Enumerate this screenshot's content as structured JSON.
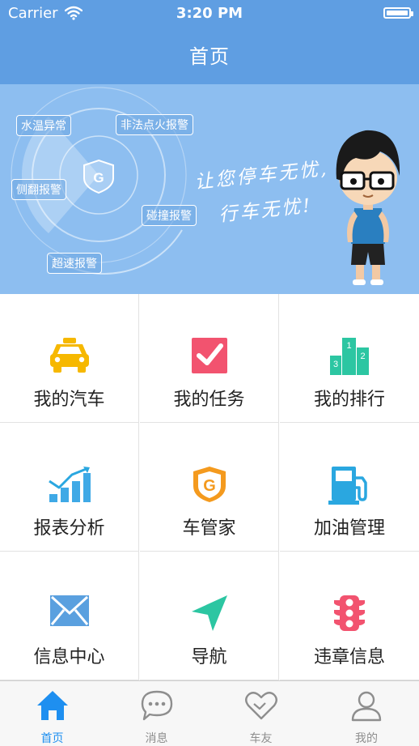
{
  "status_bar": {
    "carrier": "Carrier",
    "time": "3:20 PM"
  },
  "nav": {
    "title": "首页"
  },
  "banner": {
    "tags": [
      "水温异常",
      "非法点火报警",
      "侧翻报警",
      "碰撞报警",
      "超速报警"
    ],
    "slogan_line1": "让您停车无忧,",
    "slogan_line2": "行车无忧!"
  },
  "grid": {
    "items": [
      {
        "label": "我的汽车",
        "icon": "car-icon",
        "color": "#f6b800"
      },
      {
        "label": "我的任务",
        "icon": "task-check-icon",
        "color": "#f2536f"
      },
      {
        "label": "我的排行",
        "icon": "ranking-podium-icon",
        "color": "#2cc6a2"
      },
      {
        "label": "报表分析",
        "icon": "report-chart-icon",
        "color": "#3fa9e6"
      },
      {
        "label": "车管家",
        "icon": "car-butler-shield-icon",
        "color": "#f49a1e"
      },
      {
        "label": "加油管理",
        "icon": "fuel-pump-icon",
        "color": "#2aa7e0"
      },
      {
        "label": "信息中心",
        "icon": "envelope-icon",
        "color": "#5aa0df"
      },
      {
        "label": "导航",
        "icon": "navigation-arrow-icon",
        "color": "#2cc6a2"
      },
      {
        "label": "违章信息",
        "icon": "traffic-light-icon",
        "color": "#f2536f"
      }
    ]
  },
  "tabbar": {
    "tabs": [
      {
        "label": "首页",
        "icon": "home-icon",
        "active": true
      },
      {
        "label": "消息",
        "icon": "chat-bubble-icon",
        "active": false
      },
      {
        "label": "车友",
        "icon": "heart-icon",
        "active": false
      },
      {
        "label": "我的",
        "icon": "person-icon",
        "active": false
      }
    ],
    "active_color": "#1e8ff0",
    "inactive_color": "#8e8e8e"
  },
  "colors": {
    "header": "#5f9ee2",
    "banner": "#8dbef0"
  }
}
